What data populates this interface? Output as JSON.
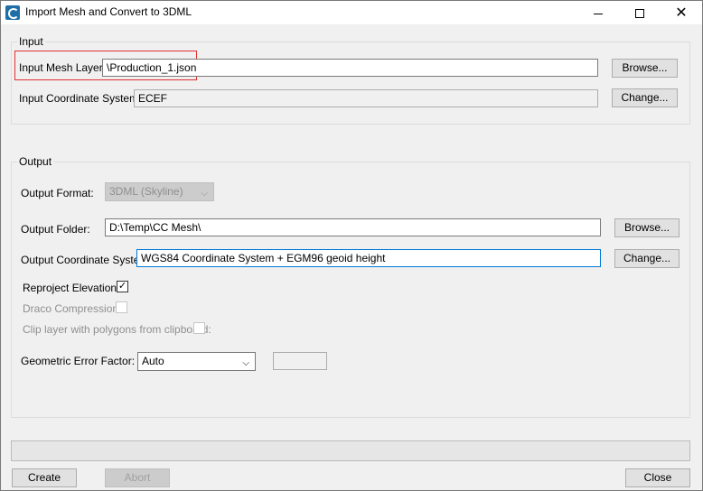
{
  "window": {
    "title": "Import Mesh and Convert to 3DML",
    "minimize_glyph": "",
    "maximize_glyph": "",
    "close_glyph": "✕"
  },
  "input_group": {
    "label": "Input",
    "mesh_layer_label": "Input Mesh Layer:",
    "mesh_layer_value": "\\Production_1.json",
    "browse_label": "Browse...",
    "coord_label": "Input Coordinate System:",
    "coord_value": "ECEF",
    "change_label": "Change..."
  },
  "output_group": {
    "label": "Output",
    "format_label": "Output Format:",
    "format_value": "3DML (Skyline)",
    "folder_label": "Output Folder:",
    "folder_value": "D:\\Temp\\CC Mesh\\",
    "folder_browse_label": "Browse...",
    "coord_label": "Output Coordinate System:",
    "coord_value": "WGS84 Coordinate System + EGM96 geoid height",
    "coord_change_label": "Change...",
    "reproject_label": "Reproject Elevation:",
    "reproject_checked": true,
    "draco_label": "Draco Compression:",
    "draco_checked": false,
    "clip_label": "Clip layer with polygons from clipboard:",
    "clip_checked": false,
    "error_factor_label": "Geometric Error Factor:",
    "error_factor_value": "Auto",
    "error_factor_custom": ""
  },
  "progress": {
    "value": 0
  },
  "footer": {
    "create_label": "Create",
    "abort_label": "Abort",
    "close_label": "Close"
  },
  "icons": {
    "dropdown": "⌵",
    "check": "✓"
  }
}
